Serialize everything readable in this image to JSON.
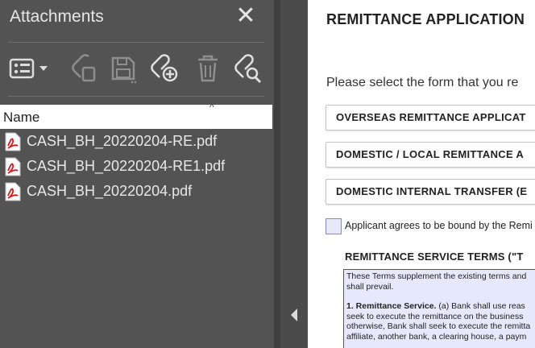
{
  "attachments_panel": {
    "title": "Attachments",
    "close_icon": "close-icon",
    "toolbar": {
      "icons": [
        "list-options-icon",
        "attach-file-icon",
        "save-attachment-icon",
        "add-attachment-icon",
        "delete-icon",
        "search-attachment-icon"
      ]
    },
    "column_header": "Name",
    "files": [
      {
        "name": "CASH_BH_20220204-RE.pdf",
        "icon": "pdf-icon"
      },
      {
        "name": "CASH_BH_20220204-RE1.pdf",
        "icon": "pdf-icon"
      },
      {
        "name": "CASH_BH_20220204.pdf",
        "icon": "pdf-icon"
      }
    ]
  },
  "document": {
    "title": "REMITTANCE APPLICATION",
    "prompt": "Please select the form that you re",
    "options": [
      "OVERSEAS REMITTANCE  APPLICAT",
      "DOMESTIC / LOCAL REMITTANCE  A",
      "DOMESTIC INTERNAL TRANSFER (E"
    ],
    "agree_text": "Applicant agrees to be bound by the Remi",
    "terms_heading": "REMITTANCE SERVICE TERMS (\"T",
    "terms_paragraph_1": [
      "These Terms supplement the existing terms and",
      "shall prevail."
    ],
    "terms_paragraph_2": {
      "lead": "1. Remittance Service.",
      "lines": [
        " (a) Bank shall use reas",
        "seek to execute the remittance on the business",
        "otherwise, Bank shall seek to execute the remitta",
        "affiliate, another bank, a clearing house, a paym"
      ]
    }
  },
  "colors": {
    "panel_bg": "#535353",
    "pdf_red": "#d7191f",
    "checkbox_fill": "#e7e9fb"
  }
}
